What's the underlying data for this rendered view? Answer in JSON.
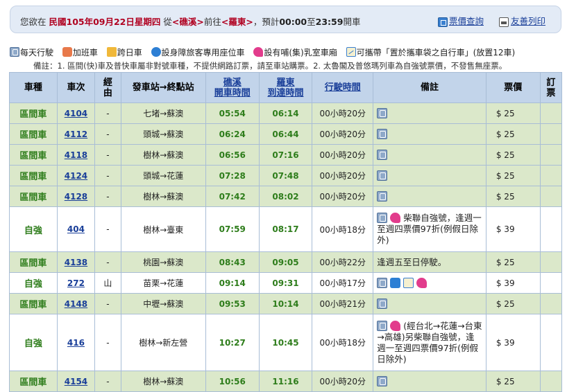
{
  "header": {
    "prefix": "您欲在",
    "date": "民國105年09月22日星期四",
    "from_label": "從",
    "origin": "<礁溪>",
    "to_label": "前往",
    "destination": "<羅東>",
    "time_prefix": "，預計",
    "time_start": "00:00",
    "time_mid": "至",
    "time_end": "23:59",
    "time_suffix": "開車",
    "fare_link": "票價查詢",
    "print_link": "友善列印"
  },
  "legend": {
    "daily": "每天行駛",
    "extra": "加班車",
    "crossday": "跨日車",
    "accessible": "設身障旅客專用座位車",
    "nursing": "設有哺(集)乳室車廂",
    "bike": "可攜帶「置於攜車袋之自行車」(放置12車)"
  },
  "note": "備註：1. 區間(快)車及普快車屬非對號車種，不提供網路訂票，請至車站購票。2. 太魯閣及普悠瑪列車為自強號票價，不發售無座票。",
  "columns": {
    "type": "車種",
    "number": "車次",
    "via": "經由",
    "route": "發車站→終點站",
    "dep_line1": "礁溪",
    "dep_line2": "開車時間",
    "arr_line1": "羅東",
    "arr_line2": "到達時間",
    "duration": "行駛時間",
    "note": "備註",
    "fare": "票價",
    "book_line1": "訂",
    "book_line2": "票"
  },
  "rows": [
    {
      "type": "區間車",
      "number": "4104",
      "via": "-",
      "route": "七堵→蘇澳",
      "dep": "05:54",
      "arr": "06:14",
      "duration": "00小時20分",
      "icons": [
        "daily-icon"
      ],
      "note": "",
      "fare": "$ 25",
      "book": ""
    },
    {
      "type": "區間車",
      "number": "4112",
      "via": "-",
      "route": "頭城→蘇澳",
      "dep": "06:24",
      "arr": "06:44",
      "duration": "00小時20分",
      "icons": [
        "daily-icon"
      ],
      "note": "",
      "fare": "$ 25",
      "book": ""
    },
    {
      "type": "區間車",
      "number": "4118",
      "via": "-",
      "route": "樹林→蘇澳",
      "dep": "06:56",
      "arr": "07:16",
      "duration": "00小時20分",
      "icons": [
        "daily-icon"
      ],
      "note": "",
      "fare": "$ 25",
      "book": ""
    },
    {
      "type": "區間車",
      "number": "4124",
      "via": "-",
      "route": "頭城→花蓮",
      "dep": "07:28",
      "arr": "07:48",
      "duration": "00小時20分",
      "icons": [
        "daily-icon"
      ],
      "note": "",
      "fare": "$ 25",
      "book": ""
    },
    {
      "type": "區間車",
      "number": "4128",
      "via": "-",
      "route": "樹林→蘇澳",
      "dep": "07:42",
      "arr": "08:02",
      "duration": "00小時20分",
      "icons": [
        "daily-icon"
      ],
      "note": "",
      "fare": "$ 25",
      "book": ""
    },
    {
      "type": "自強",
      "number": "404",
      "via": "-",
      "route": "樹林→臺東",
      "dep": "07:59",
      "arr": "08:17",
      "duration": "00小時18分",
      "icons": [
        "daily-icon",
        "nursing-icon"
      ],
      "note": "柴聯自強號，逢週一至週四票價97折(例假日除外)",
      "fare": "$ 39",
      "book": ""
    },
    {
      "type": "區間車",
      "number": "4138",
      "via": "-",
      "route": "桃園→蘇澳",
      "dep": "08:43",
      "arr": "09:05",
      "duration": "00小時22分",
      "icons": [],
      "note": "逢週五至日停駛。",
      "fare": "$ 25",
      "book": ""
    },
    {
      "type": "自強",
      "number": "272",
      "via": "山",
      "route": "苗栗→花蓮",
      "dep": "09:14",
      "arr": "09:31",
      "duration": "00小時17分",
      "icons": [
        "daily-icon",
        "wheelchair-icon",
        "bike-icon",
        "nursing-icon"
      ],
      "note": "",
      "fare": "$ 39",
      "book": ""
    },
    {
      "type": "區間車",
      "number": "4148",
      "via": "-",
      "route": "中壢→蘇澳",
      "dep": "09:53",
      "arr": "10:14",
      "duration": "00小時21分",
      "icons": [
        "daily-icon"
      ],
      "note": "",
      "fare": "$ 25",
      "book": ""
    },
    {
      "type": "自強",
      "number": "416",
      "via": "-",
      "route": "樹林→新左營",
      "dep": "10:27",
      "arr": "10:45",
      "duration": "00小時18分",
      "icons": [
        "daily-icon",
        "nursing-icon"
      ],
      "note": "(經台北→花蓮→台東→高雄)另柴聯自強號，逢週一至週四票價97折(例假日除外)",
      "fare": "$ 39",
      "book": ""
    },
    {
      "type": "區間車",
      "number": "4154",
      "via": "-",
      "route": "樹林→蘇澳",
      "dep": "10:56",
      "arr": "11:16",
      "duration": "00小時20分",
      "icons": [
        "daily-icon"
      ],
      "note": "",
      "fare": "$ 25",
      "book": ""
    }
  ]
}
